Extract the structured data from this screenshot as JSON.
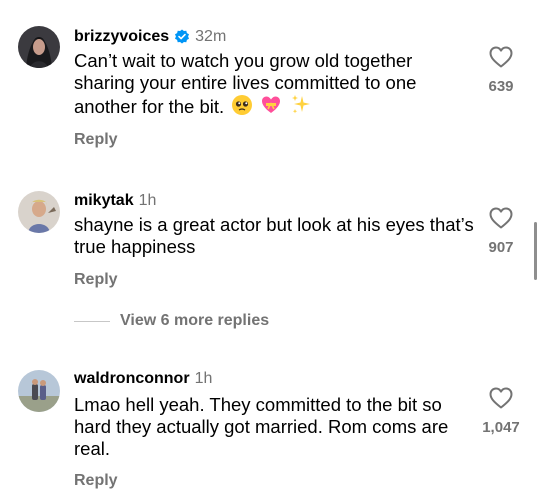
{
  "comments": [
    {
      "username": "brizzyvoices",
      "verified": true,
      "time": "32m",
      "text": "Can’t wait to watch you grow old together sharing your entire lives committed to one another for the bit.",
      "emojis": [
        "pleading-face",
        "heart-with-ribbon",
        "sparkles"
      ],
      "reply_label": "Reply",
      "likes": "639"
    },
    {
      "username": "mikytak",
      "verified": false,
      "time": "1h",
      "text": "shayne is a great actor but look at his eyes that’s true happiness",
      "reply_label": "Reply",
      "likes": "907",
      "more_replies_label": "View 6 more replies"
    },
    {
      "username": "waldronconnor",
      "verified": false,
      "time": "1h",
      "text": "Lmao hell yeah. They committed to the bit so hard they actually got married. Rom coms are real.",
      "reply_label": "Reply",
      "likes": "1,047"
    }
  ],
  "colors": {
    "secondary_text": "#737373",
    "verified_blue": "#0095f6",
    "divider": "#c7c7c7"
  }
}
